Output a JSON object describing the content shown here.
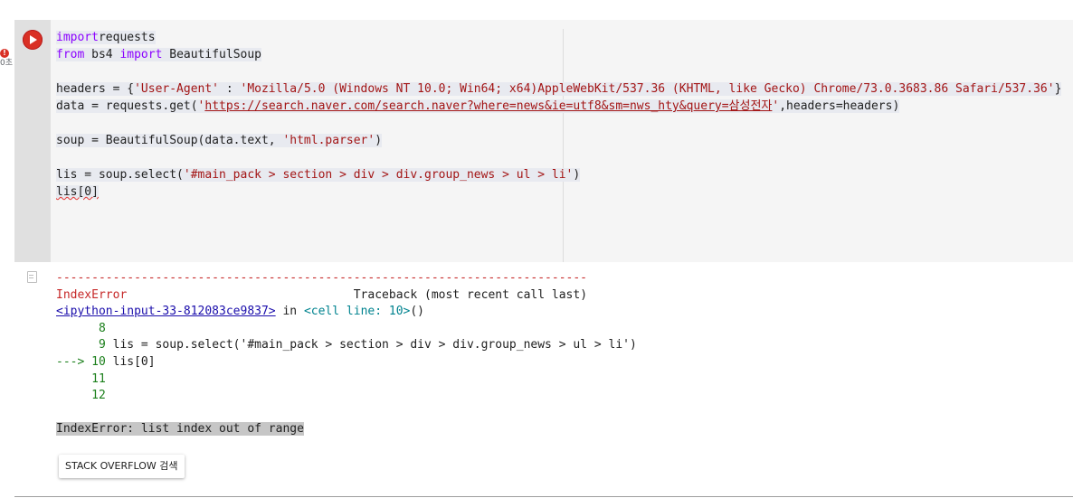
{
  "status": {
    "error_glyph": "!",
    "exec_time": "0초"
  },
  "editor": {
    "lines": [
      [
        [
          "kw",
          "import"
        ],
        [
          "",
          "requests"
        ]
      ],
      [
        [
          "kw",
          "from"
        ],
        [
          "",
          " bs4 "
        ],
        [
          "kw",
          "import"
        ],
        [
          "",
          " BeautifulSoup"
        ]
      ],
      [],
      [
        [
          "",
          "headers = {"
        ],
        [
          "str",
          "'User-Agent'"
        ],
        [
          "",
          " : "
        ],
        [
          "str",
          "'Mozilla/5.0 (Windows NT 10.0; Win64; x64)AppleWebKit/537.36 (KHTML, like Gecko) Chrome/73.0.3683.86 Safari/537.36'"
        ],
        [
          "",
          "}"
        ]
      ],
      [
        [
          "",
          "data = requests.get("
        ],
        [
          "str",
          "'"
        ],
        [
          "url",
          "https://search.naver.com/search.naver?where=news&ie=utf8&sm=nws_hty&query=삼성전자"
        ],
        [
          "str",
          "'"
        ],
        [
          "",
          ",headers=headers)"
        ]
      ],
      [],
      [
        [
          "",
          "soup = BeautifulSoup(data.text, "
        ],
        [
          "str",
          "'html.parser'"
        ],
        [
          "",
          ")"
        ]
      ],
      [],
      [
        [
          "",
          "lis = soup.select("
        ],
        [
          "str",
          "'#main_pack > section > div > div.group_news > ul > li'"
        ],
        [
          "",
          ")"
        ]
      ],
      [
        [
          "squiggle",
          "lis[0]"
        ]
      ]
    ]
  },
  "output": {
    "lines": [
      [
        [
          "tb-red",
          "---------------------------------------------------------------------------"
        ]
      ],
      [
        [
          "tb-red",
          "IndexError"
        ],
        [
          "",
          "                                Traceback (most recent call last)"
        ]
      ],
      [
        [
          "tb-link",
          "<ipython-input-33-812083ce9837>"
        ],
        [
          "",
          " in "
        ],
        [
          "tb-cyan",
          "<cell line: 10>"
        ],
        [
          "",
          "()"
        ]
      ],
      [
        [
          "tb-green",
          "      8"
        ]
      ],
      [
        [
          "tb-green",
          "      9"
        ],
        [
          "",
          " lis = soup.select('#main_pack > section > div > div.group_news > ul > li')"
        ]
      ],
      [
        [
          "tb-green",
          "---> 10"
        ],
        [
          "",
          " lis[0]"
        ]
      ],
      [
        [
          "tb-green",
          "     11"
        ]
      ],
      [
        [
          "tb-green",
          "     12"
        ]
      ],
      [],
      [
        [
          "err-final",
          "IndexError: list index out of range"
        ]
      ]
    ],
    "search_button_label": "STACK OVERFLOW 검색"
  }
}
